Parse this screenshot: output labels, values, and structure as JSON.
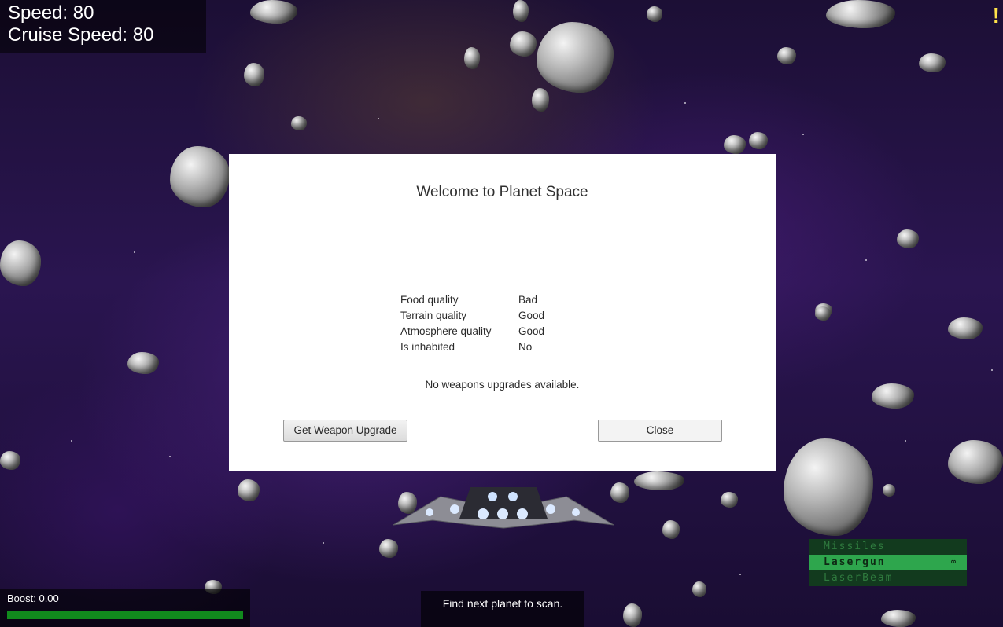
{
  "hud": {
    "speed_label": "Speed: 80",
    "cruise_label": "Cruise Speed: 80",
    "alert_symbol": "!"
  },
  "dialog": {
    "title": "Welcome to Planet Space",
    "stats": [
      {
        "label": "Food quality",
        "value": "Bad"
      },
      {
        "label": "Terrain quality",
        "value": "Good"
      },
      {
        "label": "Atmosphere quality",
        "value": "Good"
      },
      {
        "label": "Is inhabited",
        "value": "No"
      }
    ],
    "notice": "No weapons upgrades available.",
    "upgrade_button": "Get Weapon Upgrade",
    "close_button": "Close"
  },
  "weapons": [
    {
      "name": "Missiles",
      "ammo": "",
      "active": false
    },
    {
      "name": "Lasergun",
      "ammo": "∞",
      "active": true
    },
    {
      "name": "LaserBeam",
      "ammo": "",
      "active": false
    }
  ],
  "boost": {
    "label": "Boost: 0.00",
    "level_percent": 100
  },
  "objective": "Find next planet to scan.",
  "colors": {
    "boost_fill": "#118a1d",
    "weapon_active": "#2ea64d",
    "alert": "#ffe34a"
  }
}
